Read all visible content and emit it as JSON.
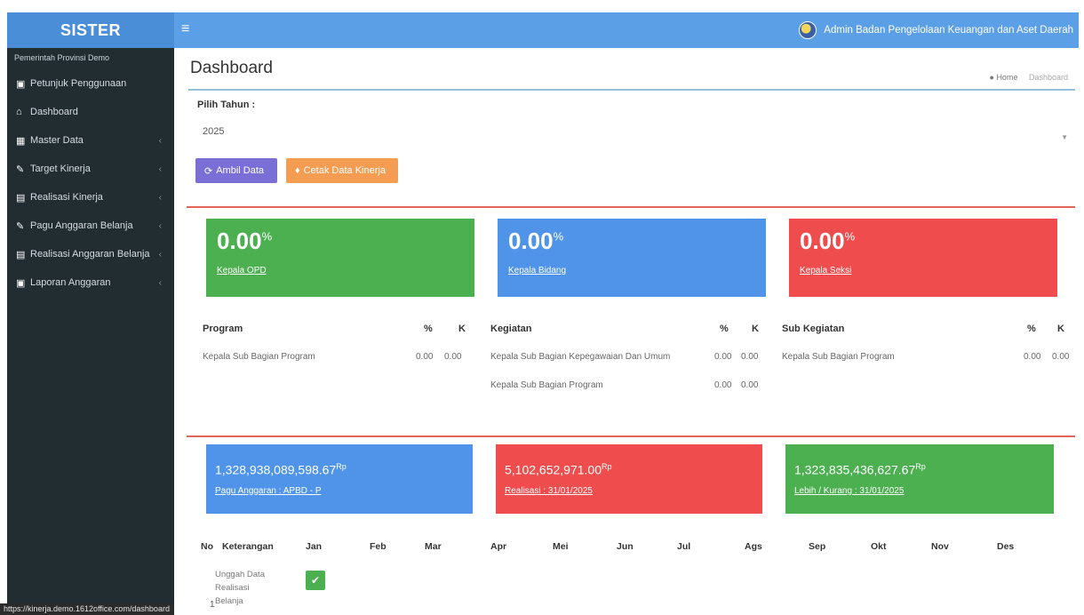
{
  "app": {
    "logo": "SISTER"
  },
  "header": {
    "menu_icon": "hamburger-icon",
    "user_name": "Admin Badan Pengelolaan Keuangan dan Aset Daerah"
  },
  "sidebar": {
    "org": "Pemerintah Provinsi Demo",
    "items": [
      {
        "label": "Petunjuk Penggunaan",
        "icon": "book-icon",
        "chevron": false
      },
      {
        "label": "Dashboard",
        "icon": "home-icon",
        "chevron": false
      },
      {
        "label": "Master Data",
        "icon": "database-icon",
        "chevron": true
      },
      {
        "label": "Target Kinerja",
        "icon": "pencil-icon",
        "chevron": true
      },
      {
        "label": "Realisasi Kinerja",
        "icon": "document-icon",
        "chevron": true
      },
      {
        "label": "Pagu Anggaran Belanja",
        "icon": "pencil-icon",
        "chevron": true
      },
      {
        "label": "Realisasi Anggaran Belanja",
        "icon": "document-icon",
        "chevron": true
      },
      {
        "label": "Laporan Anggaran",
        "icon": "book-icon",
        "chevron": true
      }
    ]
  },
  "page": {
    "title": "Dashboard",
    "breadcrumb_home": "Home",
    "breadcrumb_current": "Dashboard"
  },
  "filter": {
    "year_label": "Pilih Tahun :",
    "year_value": "2025"
  },
  "buttons": {
    "ambil": "Ambil Data",
    "cetak": "Cetak Data Kinerja"
  },
  "kinerja": [
    {
      "value": "0.00",
      "unit": "%",
      "label": "Kepala OPD",
      "color": "#4caf50"
    },
    {
      "value": "0.00",
      "unit": "%",
      "label": "Kepala Bidang",
      "color": "#4f94e8"
    },
    {
      "value": "0.00",
      "unit": "%",
      "label": "Kepala Seksi",
      "color": "#ef4d4d"
    }
  ],
  "tables": {
    "program": {
      "title": "Program",
      "pct": "%",
      "k": "K",
      "rows": [
        {
          "name": "Kepala Sub Bagian Program",
          "pct": "0.00",
          "k": "0.00"
        }
      ]
    },
    "kegiatan": {
      "title": "Kegiatan",
      "pct": "%",
      "k": "K",
      "rows": [
        {
          "name": "Kepala Sub Bagian Kepegawaian Dan Umum",
          "pct": "0.00",
          "k": "0.00"
        },
        {
          "name": "Kepala Sub Bagian Program",
          "pct": "0.00",
          "k": "0.00"
        }
      ]
    },
    "sub": {
      "title": "Sub Kegiatan",
      "pct": "%",
      "k": "K",
      "rows": [
        {
          "name": "Kepala Sub Bagian Program",
          "pct": "0.00",
          "k": "0.00"
        }
      ]
    }
  },
  "anggaran": [
    {
      "amount": "1,328,938,089,598.67",
      "unit": "Rp",
      "label": "Pagu Anggaran : APBD - P",
      "color": "#4f94e8"
    },
    {
      "amount": "5,102,652,971.00",
      "unit": "Rp",
      "label": "Realisasi : 31/01/2025",
      "color": "#ef4d4d"
    },
    {
      "amount": "1,323,835,436,627.67",
      "unit": "Rp",
      "label": "Lebih / Kurang : 31/01/2025",
      "color": "#4caf50"
    }
  ],
  "monthly": {
    "headers": [
      "No",
      "Keterangan",
      "Jan",
      "Feb",
      "Mar",
      "Apr",
      "Mei",
      "Jun",
      "Jul",
      "Ags",
      "Sep",
      "Okt",
      "Nov",
      "Des"
    ],
    "row": {
      "no": "1",
      "ket": "Unggah Data Realisasi Belanja"
    }
  },
  "statusbar": {
    "url": "https://kinerja.demo.1612office.com/dashboard"
  }
}
